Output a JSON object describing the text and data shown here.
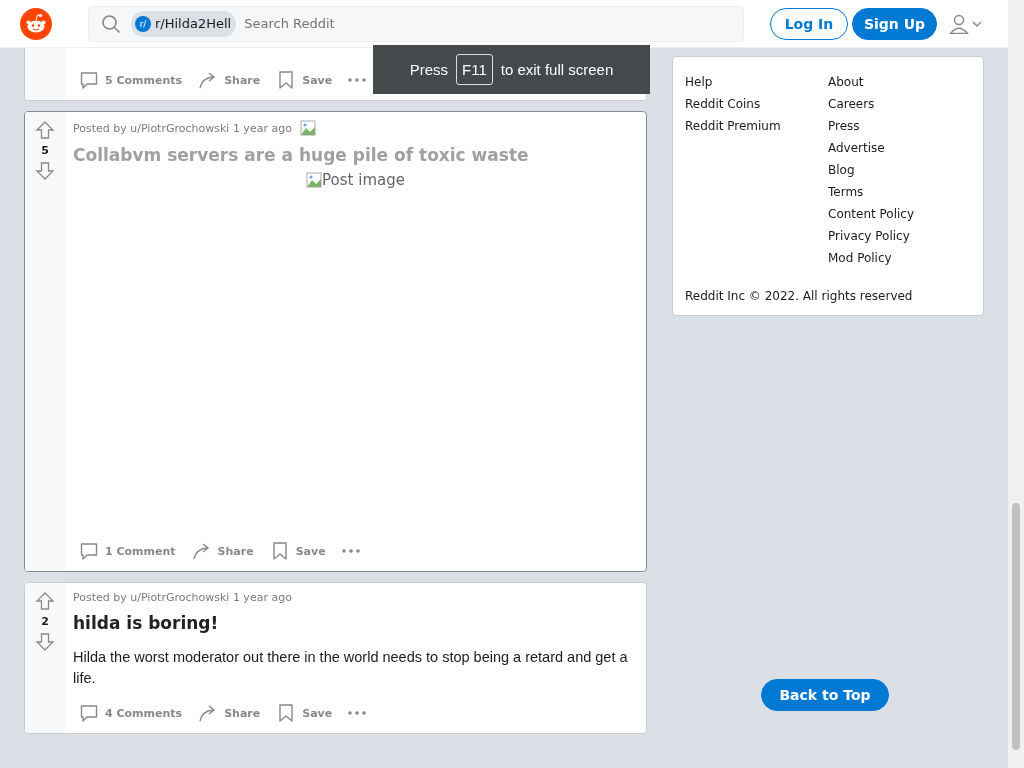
{
  "header": {
    "community": "r/Hilda2Hell",
    "community_icon": "r/",
    "search_placeholder": "Search Reddit",
    "login": "Log In",
    "signup": "Sign Up"
  },
  "fullscreen_toast": {
    "before": "Press",
    "key": "F11",
    "after": "to exit full screen"
  },
  "posts": [
    {
      "kind": "actions_only",
      "selected": false,
      "comments": "5 Comments",
      "share": "Share",
      "save": "Save"
    },
    {
      "kind": "image",
      "selected": true,
      "votes": "5",
      "meta": "Posted by u/PiotrGrochowski 1 year ago",
      "title": "Collabvm servers are a huge pile of toxic waste",
      "visited": true,
      "image_alt": "Post image",
      "comments": "1 Comment",
      "share": "Share",
      "save": "Save"
    },
    {
      "kind": "text",
      "selected": false,
      "votes": "2",
      "meta": "Posted by u/PiotrGrochowski 1 year ago",
      "title": "hilda is boring!",
      "visited": false,
      "body": "Hilda the worst moderator out there in the world needs to stop being a retard and get a life.",
      "comments": "4 Comments",
      "share": "Share",
      "save": "Save"
    }
  ],
  "footer": {
    "column_1": [
      "Help",
      "Reddit Coins",
      "Reddit Premium"
    ],
    "column_2": [
      "About",
      "Careers",
      "Press",
      "Advertise",
      "Blog",
      "Terms",
      "Content Policy",
      "Privacy Policy",
      "Mod Policy"
    ],
    "copyright": "Reddit Inc © 2022. All rights reserved"
  },
  "back_to_top": "Back to Top"
}
